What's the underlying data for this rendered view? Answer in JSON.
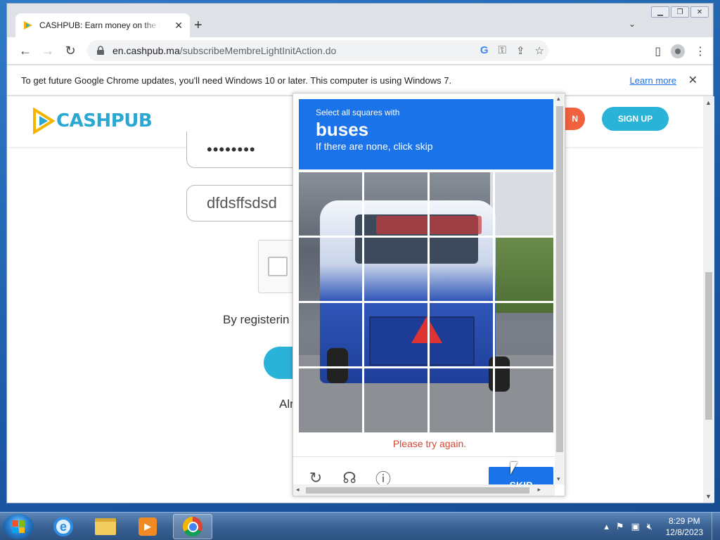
{
  "browser": {
    "tab_title": "CASHPUB: Earn money on the internet",
    "url_host": "en.cashpub.ma",
    "url_path": "/subscribeMembreLightInitAction.do",
    "new_tab_glyph": "+",
    "tab_close_glyph": "✕"
  },
  "infobar": {
    "message": "To get future Google Chrome updates, you'll need Windows 10 or later. This computer is using Windows 7.",
    "link": "Learn more"
  },
  "site": {
    "logo_text": "CASHPUB",
    "login_label": "N",
    "signup_label": "SIGN UP",
    "password_mask": "••••••••",
    "text_field_value": "dfdsffsdsd",
    "register_text": "By registerin",
    "already_text": "Alr"
  },
  "captcha": {
    "prompt": "Select all squares with",
    "target": "buses",
    "subprompt": "If there are none, click skip",
    "error": "Please try again.",
    "skip_label": "SKIP",
    "icons": [
      "reload-icon",
      "audio-icon",
      "info-icon"
    ]
  },
  "taskbar": {
    "time": "8:29 PM",
    "date": "12/8/2023",
    "apps": [
      "internet-explorer",
      "file-explorer",
      "media-player",
      "google-chrome"
    ]
  },
  "colors": {
    "accent": "#1a73e8",
    "brand": "#2ab3d8",
    "error": "#d14836",
    "login": "#f0623e"
  }
}
